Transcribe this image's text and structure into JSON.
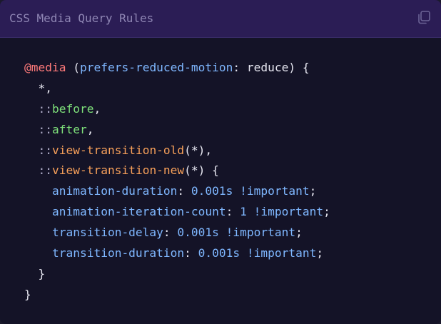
{
  "window": {
    "title": "CSS Media Query Rules",
    "copy_icon": "copy-icon"
  },
  "colors": {
    "header_bg": "#2b1d55",
    "body_bg": "#141327",
    "at_rule": "#ff7a7a",
    "feature": "#7fb7ff",
    "pseudo": "#7ee07a",
    "function": "#f7a05a",
    "text": "#e6e6f0"
  },
  "code": {
    "l1": {
      "at": "@media",
      "open": "(",
      "feature": "prefers-reduced-motion",
      "colon": ":",
      "value": "reduce",
      "close": ")",
      "brace": "{"
    },
    "l2": {
      "selector": "*",
      "comma": ","
    },
    "l3": {
      "colons": "::",
      "name": "before",
      "comma": ","
    },
    "l4": {
      "colons": "::",
      "name": "after",
      "comma": ","
    },
    "l5": {
      "colons": "::",
      "name": "view-transition-old",
      "arg": "(*)",
      "comma": ","
    },
    "l6": {
      "colons": "::",
      "name": "view-transition-new",
      "arg": "(*)",
      "brace": "{"
    },
    "l7": {
      "prop": "animation-duration",
      "colon": ":",
      "value": "0.001s",
      "important": "!important",
      "semi": ";"
    },
    "l8": {
      "prop": "animation-iteration-count",
      "colon": ":",
      "value": "1",
      "important": "!important",
      "semi": ";"
    },
    "l9": {
      "prop": "transition-delay",
      "colon": ":",
      "value": "0.001s",
      "important": "!important",
      "semi": ";"
    },
    "l10": {
      "prop": "transition-duration",
      "colon": ":",
      "value": "0.001s",
      "important": "!important",
      "semi": ";"
    },
    "l11": {
      "brace": "}"
    },
    "l12": {
      "brace": "}"
    }
  }
}
